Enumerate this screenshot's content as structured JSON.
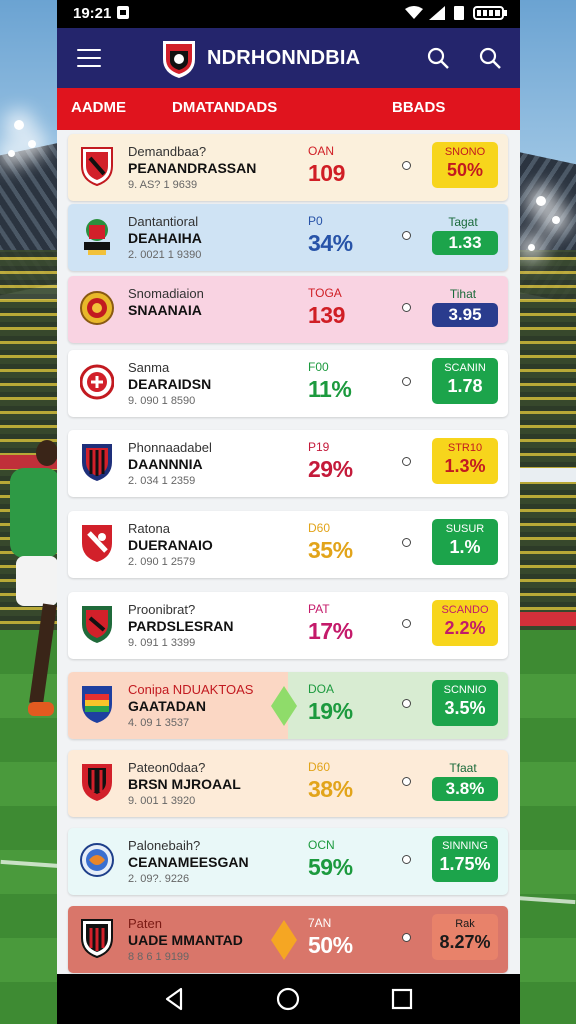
{
  "status": {
    "time": "19:21"
  },
  "app": {
    "title": "NDRHONNDBIA"
  },
  "header": {
    "col1": "AADME",
    "col2": "DMATANDADS",
    "col3": "BBADS"
  },
  "colors": {
    "appbar": "#24256c",
    "header": "#e0141e"
  },
  "rows": [
    {
      "name1": "Demandbaa?",
      "name2": "PEANANDRASSAN",
      "meta": "9. AS? 1 9639",
      "stat_label": "OAN",
      "stat_value": "109",
      "stat_color": "#d01e25",
      "odds_label": "SNONO",
      "odds_value": "50%",
      "pill_bg": "#f7d51c",
      "pill_fg": "#c21a20",
      "big": true,
      "card_bg": "#fbf0dc",
      "badge": "shield-red"
    },
    {
      "name1": "Dantantioral",
      "name2": "DEAHAIHA",
      "meta": "2. 0021 1 9390",
      "stat_label": "P0",
      "stat_value": "34%",
      "stat_color": "#2753a8",
      "odds_label": "Tagat",
      "odds_value": "1.33",
      "pill_bg": "#1ca44b",
      "pill_fg": "#ffffff",
      "big": false,
      "card_bg": "#cfe3f4",
      "badge": "crest-trophy"
    },
    {
      "name1": "Snomadiaion",
      "name2": "SNAANAIA",
      "meta": "",
      "stat_label": "TOGA",
      "stat_value": "139",
      "stat_color": "#d01e25",
      "odds_label": "Tihat",
      "odds_value": "3.95",
      "pill_bg": "#2a3c8e",
      "pill_fg": "#ffffff",
      "big": false,
      "card_bg": "#f9d3e2",
      "badge": "round-gold"
    },
    {
      "name1": "Sanma",
      "name2": "DEARAIDSN",
      "meta": "9. 090 1 8590",
      "stat_label": "F00",
      "stat_value": "11%",
      "stat_color": "#1c9a3e",
      "odds_label": "SCANIN",
      "odds_value": "1.78",
      "pill_bg": "#1ca44b",
      "pill_fg": "#ffffff",
      "big": true,
      "card_bg": "#ffffff",
      "badge": "round-red"
    },
    {
      "name1": "Phonnaadabel",
      "name2": "DAANNNIA",
      "meta": "2. 034 1 2359",
      "stat_label": "P19",
      "stat_value": "29%",
      "stat_color": "#c41a3a",
      "odds_label": "STR10",
      "odds_value": "1.3%",
      "pill_bg": "#f7d51c",
      "pill_fg": "#c21a20",
      "big": true,
      "card_bg": "#ffffff",
      "badge": "shield-stripe"
    },
    {
      "name1": "Ratona",
      "name2": "DUERANAIO",
      "meta": "2. 090 1 2579",
      "stat_label": "D60",
      "stat_value": "35%",
      "stat_color": "#e2a41a",
      "odds_label": "SUSUR",
      "odds_value": "1.%",
      "pill_bg": "#1ca44b",
      "pill_fg": "#ffffff",
      "big": true,
      "card_bg": "#ffffff",
      "badge": "shield-red-white"
    },
    {
      "name1": "Proonibrat?",
      "name2": "PARDSLESRAN",
      "meta": "9. 091 1 3399",
      "stat_label": "PAT",
      "stat_value": "17%",
      "stat_color": "#c41a6a",
      "odds_label": "SCANDO",
      "odds_value": "2.2%",
      "pill_bg": "#f7d51c",
      "pill_fg": "#c21a6a",
      "big": true,
      "card_bg": "#ffffff",
      "badge": "shield-dark"
    },
    {
      "name1": "Conipa NDUAKTOAS",
      "name2": "GAATADAN",
      "meta": "4. 09 1 3537",
      "stat_label": "DOA",
      "stat_value": "19%",
      "stat_color": "#1c9a3e",
      "odds_label": "SCNNIO",
      "odds_value": "3.5%",
      "pill_bg": "#1ca44b",
      "pill_fg": "#ffffff",
      "big": true,
      "card_bg": "linear-gradient(90deg,#fbd7c4 0%,#fbd7c4 50%,#d8ecd2 50%,#d8ecd2 100%)",
      "badge": "shield-rainbow",
      "name1_color": "#c21a20",
      "diamond": "#8fdc6a"
    },
    {
      "name1": "Pateon0daa?",
      "name2": "BRSN MJROAAL",
      "meta": "9. 001 1 3920",
      "stat_label": "D60",
      "stat_value": "38%",
      "stat_color": "#e2a41a",
      "odds_label": "Tfaat",
      "odds_value": "3.8%",
      "pill_bg": "#1ca44b",
      "pill_fg": "#ffffff",
      "big": false,
      "card_bg": "#fdebd8",
      "badge": "shield-black-red"
    },
    {
      "name1": "Palonebaih?",
      "name2": "CEANAMEESGAN",
      "meta": "2. 09?. 9226",
      "stat_label": "OCN",
      "stat_value": "59%",
      "stat_color": "#1c9a3e",
      "odds_label": "SINNING",
      "odds_value": "1.75%",
      "pill_bg": "#1ca44b",
      "pill_fg": "#ffffff",
      "big": true,
      "card_bg": "#e9f8f8",
      "badge": "round-blue"
    },
    {
      "name1": "Paten",
      "name2": "UADE MMANTAD",
      "meta": "8 8 6 1 9199",
      "stat_label": "7AN",
      "stat_value": "50%",
      "stat_color": "#ffffff",
      "odds_label": "Rak",
      "odds_value": "8.27%",
      "pill_bg": "#e8826a",
      "pill_fg": "#1a1a1a",
      "big": true,
      "card_bg": "#d9766a",
      "badge": "shield-black-white",
      "name1_color": "#7a1a14",
      "diamond": "#f5a623"
    }
  ]
}
